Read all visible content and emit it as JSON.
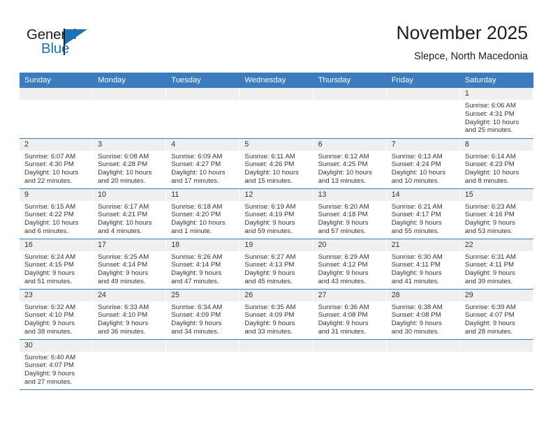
{
  "brand": {
    "word_general": "General",
    "word_blue": "Blue",
    "accent_color": "#1b72b8"
  },
  "header": {
    "title": "November 2025",
    "location": "Slepce, North Macedonia"
  },
  "theme": {
    "header_blue": "#3a7cbe",
    "band_gray": "#efefef",
    "text": "#333333"
  },
  "weekday_headers": [
    "Sunday",
    "Monday",
    "Tuesday",
    "Wednesday",
    "Thursday",
    "Friday",
    "Saturday"
  ],
  "weeks": [
    [
      {
        "day": "",
        "lines": []
      },
      {
        "day": "",
        "lines": []
      },
      {
        "day": "",
        "lines": []
      },
      {
        "day": "",
        "lines": []
      },
      {
        "day": "",
        "lines": []
      },
      {
        "day": "",
        "lines": []
      },
      {
        "day": "1",
        "lines": [
          "Sunrise: 6:06 AM",
          "Sunset: 4:31 PM",
          "Daylight: 10 hours",
          "and 25 minutes."
        ]
      }
    ],
    [
      {
        "day": "2",
        "lines": [
          "Sunrise: 6:07 AM",
          "Sunset: 4:30 PM",
          "Daylight: 10 hours",
          "and 22 minutes."
        ]
      },
      {
        "day": "3",
        "lines": [
          "Sunrise: 6:08 AM",
          "Sunset: 4:28 PM",
          "Daylight: 10 hours",
          "and 20 minutes."
        ]
      },
      {
        "day": "4",
        "lines": [
          "Sunrise: 6:09 AM",
          "Sunset: 4:27 PM",
          "Daylight: 10 hours",
          "and 17 minutes."
        ]
      },
      {
        "day": "5",
        "lines": [
          "Sunrise: 6:11 AM",
          "Sunset: 4:26 PM",
          "Daylight: 10 hours",
          "and 15 minutes."
        ]
      },
      {
        "day": "6",
        "lines": [
          "Sunrise: 6:12 AM",
          "Sunset: 4:25 PM",
          "Daylight: 10 hours",
          "and 13 minutes."
        ]
      },
      {
        "day": "7",
        "lines": [
          "Sunrise: 6:13 AM",
          "Sunset: 4:24 PM",
          "Daylight: 10 hours",
          "and 10 minutes."
        ]
      },
      {
        "day": "8",
        "lines": [
          "Sunrise: 6:14 AM",
          "Sunset: 4:23 PM",
          "Daylight: 10 hours",
          "and 8 minutes."
        ]
      }
    ],
    [
      {
        "day": "9",
        "lines": [
          "Sunrise: 6:15 AM",
          "Sunset: 4:22 PM",
          "Daylight: 10 hours",
          "and 6 minutes."
        ]
      },
      {
        "day": "10",
        "lines": [
          "Sunrise: 6:17 AM",
          "Sunset: 4:21 PM",
          "Daylight: 10 hours",
          "and 4 minutes."
        ]
      },
      {
        "day": "11",
        "lines": [
          "Sunrise: 6:18 AM",
          "Sunset: 4:20 PM",
          "Daylight: 10 hours",
          "and 1 minute."
        ]
      },
      {
        "day": "12",
        "lines": [
          "Sunrise: 6:19 AM",
          "Sunset: 4:19 PM",
          "Daylight: 9 hours",
          "and 59 minutes."
        ]
      },
      {
        "day": "13",
        "lines": [
          "Sunrise: 6:20 AM",
          "Sunset: 4:18 PM",
          "Daylight: 9 hours",
          "and 57 minutes."
        ]
      },
      {
        "day": "14",
        "lines": [
          "Sunrise: 6:21 AM",
          "Sunset: 4:17 PM",
          "Daylight: 9 hours",
          "and 55 minutes."
        ]
      },
      {
        "day": "15",
        "lines": [
          "Sunrise: 6:23 AM",
          "Sunset: 4:16 PM",
          "Daylight: 9 hours",
          "and 53 minutes."
        ]
      }
    ],
    [
      {
        "day": "16",
        "lines": [
          "Sunrise: 6:24 AM",
          "Sunset: 4:15 PM",
          "Daylight: 9 hours",
          "and 51 minutes."
        ]
      },
      {
        "day": "17",
        "lines": [
          "Sunrise: 6:25 AM",
          "Sunset: 4:14 PM",
          "Daylight: 9 hours",
          "and 49 minutes."
        ]
      },
      {
        "day": "18",
        "lines": [
          "Sunrise: 6:26 AM",
          "Sunset: 4:14 PM",
          "Daylight: 9 hours",
          "and 47 minutes."
        ]
      },
      {
        "day": "19",
        "lines": [
          "Sunrise: 6:27 AM",
          "Sunset: 4:13 PM",
          "Daylight: 9 hours",
          "and 45 minutes."
        ]
      },
      {
        "day": "20",
        "lines": [
          "Sunrise: 6:29 AM",
          "Sunset: 4:12 PM",
          "Daylight: 9 hours",
          "and 43 minutes."
        ]
      },
      {
        "day": "21",
        "lines": [
          "Sunrise: 6:30 AM",
          "Sunset: 4:11 PM",
          "Daylight: 9 hours",
          "and 41 minutes."
        ]
      },
      {
        "day": "22",
        "lines": [
          "Sunrise: 6:31 AM",
          "Sunset: 4:11 PM",
          "Daylight: 9 hours",
          "and 39 minutes."
        ]
      }
    ],
    [
      {
        "day": "23",
        "lines": [
          "Sunrise: 6:32 AM",
          "Sunset: 4:10 PM",
          "Daylight: 9 hours",
          "and 38 minutes."
        ]
      },
      {
        "day": "24",
        "lines": [
          "Sunrise: 6:33 AM",
          "Sunset: 4:10 PM",
          "Daylight: 9 hours",
          "and 36 minutes."
        ]
      },
      {
        "day": "25",
        "lines": [
          "Sunrise: 6:34 AM",
          "Sunset: 4:09 PM",
          "Daylight: 9 hours",
          "and 34 minutes."
        ]
      },
      {
        "day": "26",
        "lines": [
          "Sunrise: 6:35 AM",
          "Sunset: 4:09 PM",
          "Daylight: 9 hours",
          "and 33 minutes."
        ]
      },
      {
        "day": "27",
        "lines": [
          "Sunrise: 6:36 AM",
          "Sunset: 4:08 PM",
          "Daylight: 9 hours",
          "and 31 minutes."
        ]
      },
      {
        "day": "28",
        "lines": [
          "Sunrise: 6:38 AM",
          "Sunset: 4:08 PM",
          "Daylight: 9 hours",
          "and 30 minutes."
        ]
      },
      {
        "day": "29",
        "lines": [
          "Sunrise: 6:39 AM",
          "Sunset: 4:07 PM",
          "Daylight: 9 hours",
          "and 28 minutes."
        ]
      }
    ],
    [
      {
        "day": "30",
        "lines": [
          "Sunrise: 6:40 AM",
          "Sunset: 4:07 PM",
          "Daylight: 9 hours",
          "and 27 minutes."
        ]
      },
      {
        "day": "",
        "lines": []
      },
      {
        "day": "",
        "lines": []
      },
      {
        "day": "",
        "lines": []
      },
      {
        "day": "",
        "lines": []
      },
      {
        "day": "",
        "lines": []
      },
      {
        "day": "",
        "lines": []
      }
    ]
  ]
}
